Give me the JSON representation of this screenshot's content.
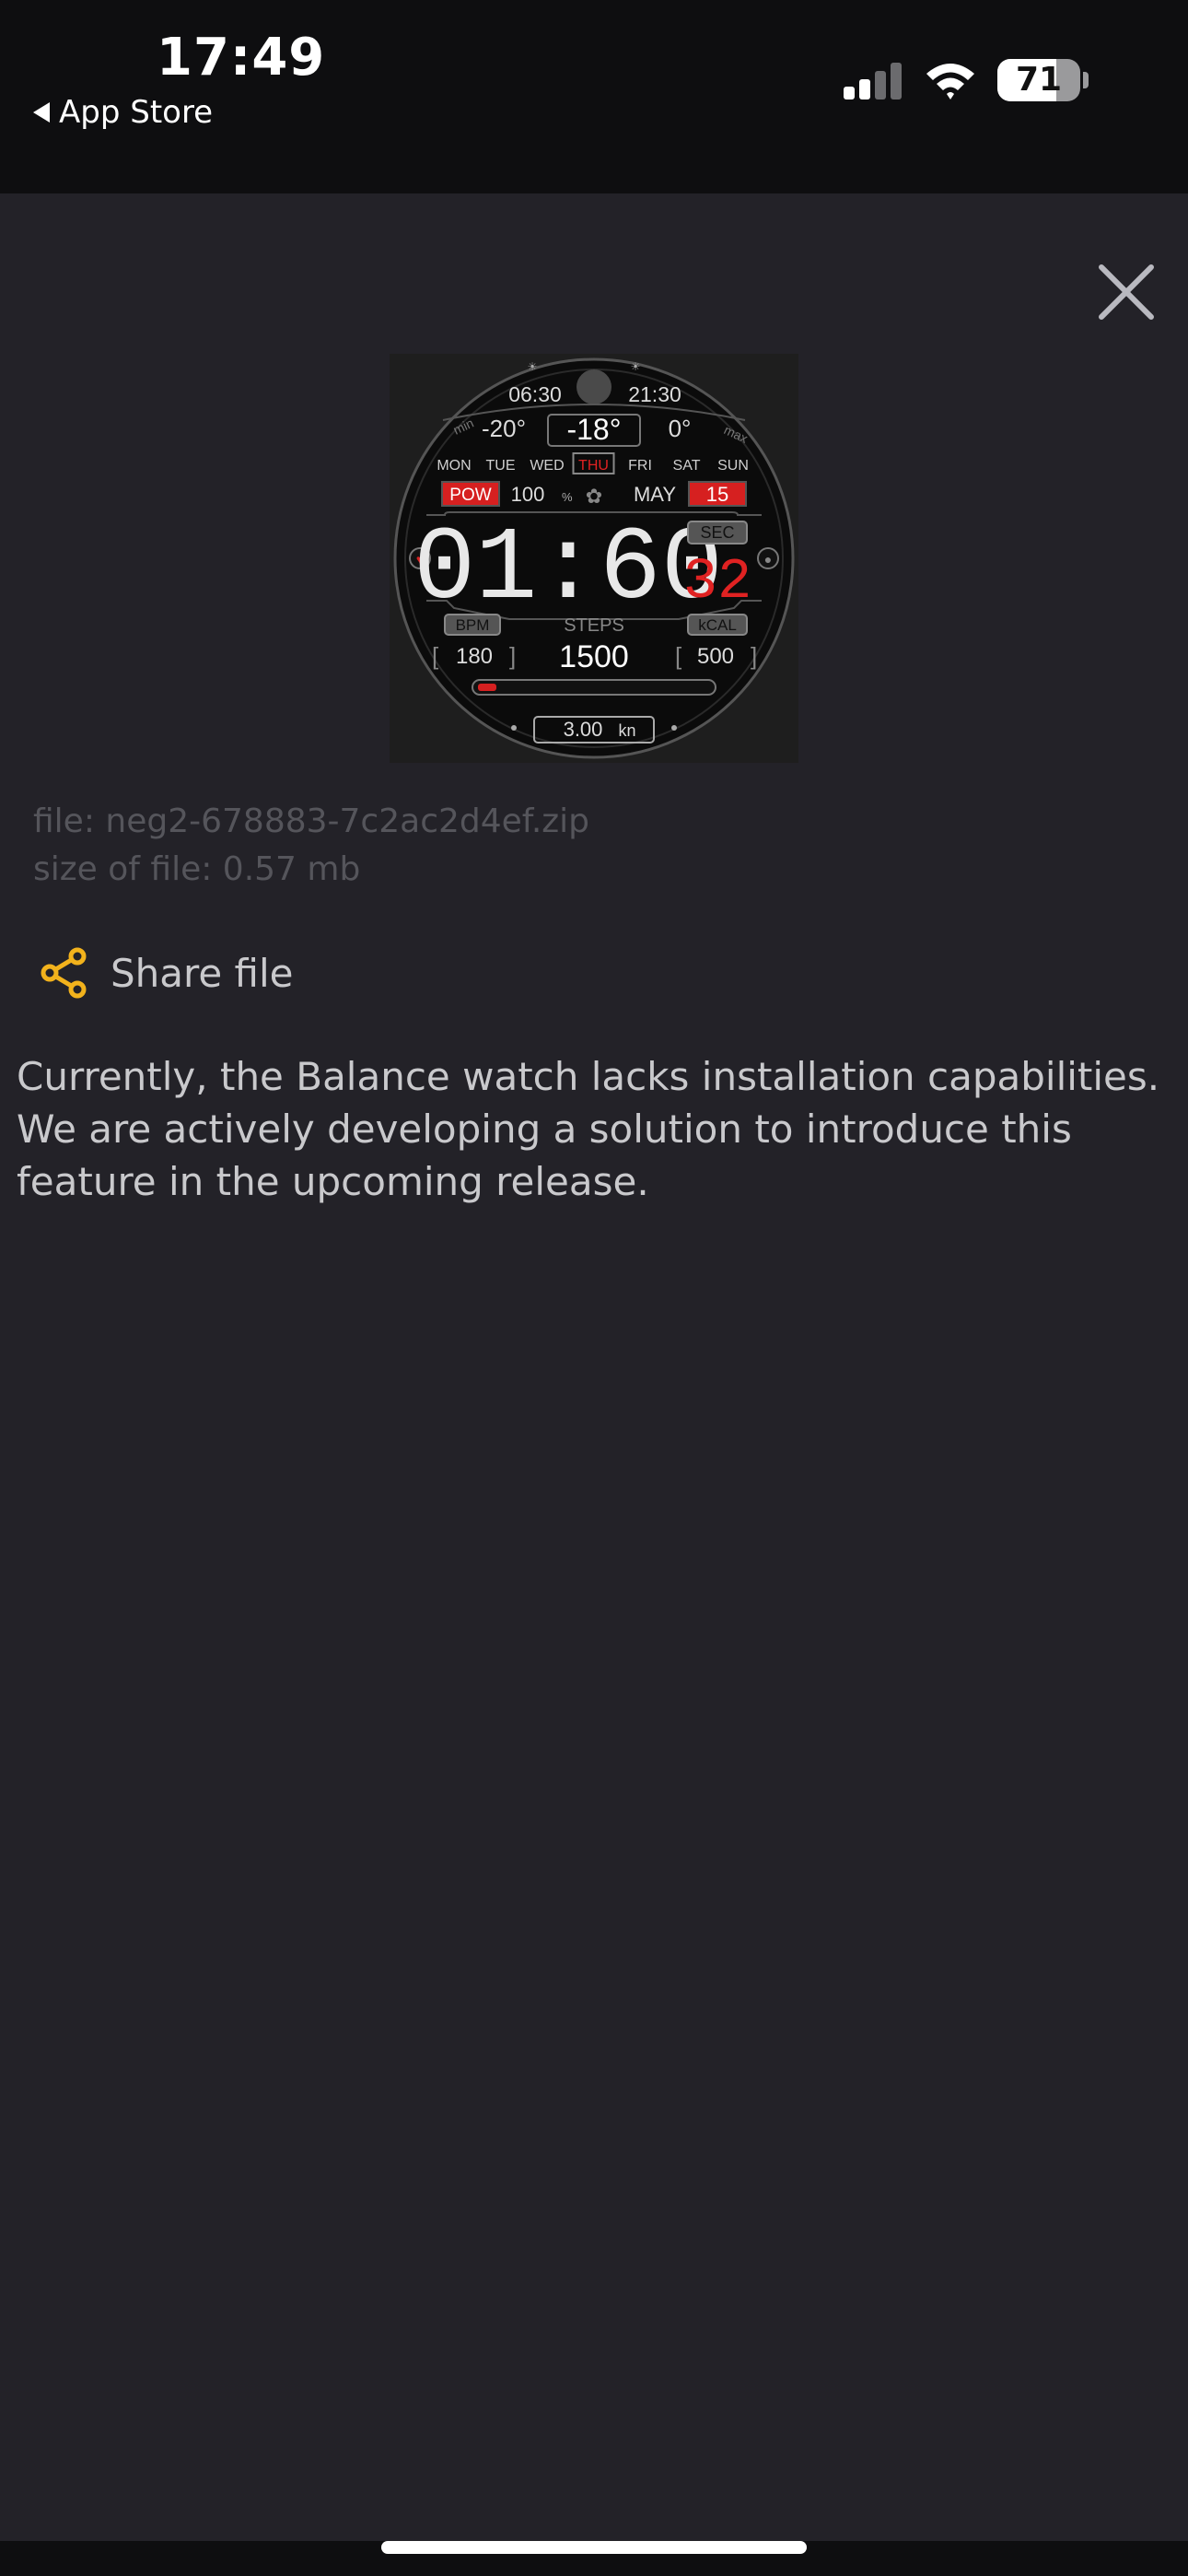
{
  "status_bar": {
    "time": "17:49",
    "back_label": "App Store",
    "battery_level": 71,
    "battery_text": "71"
  },
  "watch_face": {
    "sunrise": "06:30",
    "sunset": "21:30",
    "temp_min_label": "min",
    "temp_min": "-20°",
    "temp_current": "-18°",
    "temp_max_value": "0°",
    "temp_max_label": "max",
    "days": [
      "MON",
      "TUE",
      "WED",
      "THU",
      "FRI",
      "SAT",
      "SUN"
    ],
    "active_day": "THU",
    "pow_label": "POW",
    "pow_value": "100",
    "pow_unit": "%",
    "month": "MAY",
    "date": "15",
    "time_digits": "01:60",
    "sec_label": "SEC",
    "seconds": "32",
    "bpm_label": "BPM",
    "bpm_value": "180",
    "steps_label": "STEPS",
    "steps_value": "1500",
    "kcal_label": "kCAL",
    "kcal_value": "500",
    "distance": "3.00",
    "distance_unit": "kn",
    "accent_color": "#e02222"
  },
  "file": {
    "name_line": "file: neg2-678883-7c2ac2d4ef.zip",
    "size_line": "size of file: 0.57 mb"
  },
  "share": {
    "label": "Share file",
    "icon": "share-icon",
    "icon_color": "#f2b21c"
  },
  "message": "Currently, the Balance watch lacks installation capabilities. We are actively developing a solution to introduce this feature in the upcoming release."
}
